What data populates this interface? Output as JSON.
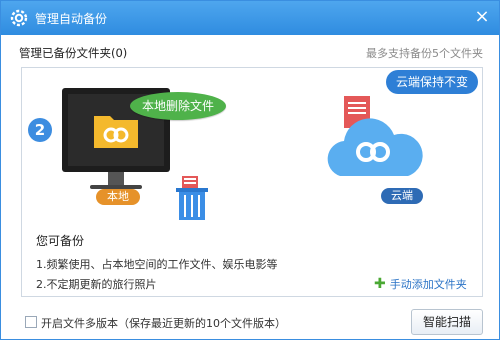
{
  "window": {
    "title": "管理自动备份",
    "close_symbol": "×"
  },
  "header": {
    "folder_count_label": "管理已备份文件夹(0)",
    "max_hint": "最多支持备份5个文件夹"
  },
  "illustration": {
    "step_number": "2",
    "local_bubble": "本地删除文件",
    "local_tag": "本地",
    "cloud_bubble": "云端保持不变",
    "cloud_tag": "云端"
  },
  "suggestions": {
    "title": "您可备份",
    "items": [
      "1.频繁使用、占本地空间的工作文件、娱乐电影等",
      "2.不定期更新的旅行照片"
    ]
  },
  "add_folder": {
    "label": "手动添加文件夹",
    "icon": "plus-icon"
  },
  "footer": {
    "checkbox_label": "开启文件多版本（保存最近更新的10个文件版本）",
    "checkbox_checked": false,
    "scan_button": "智能扫描"
  },
  "colors": {
    "titlebar": "#2f8ce0",
    "accent_blue": "#3d8de0",
    "green_bubble": "#4fb24a",
    "orange_tag": "#e6922a",
    "link": "#2a73c6"
  }
}
